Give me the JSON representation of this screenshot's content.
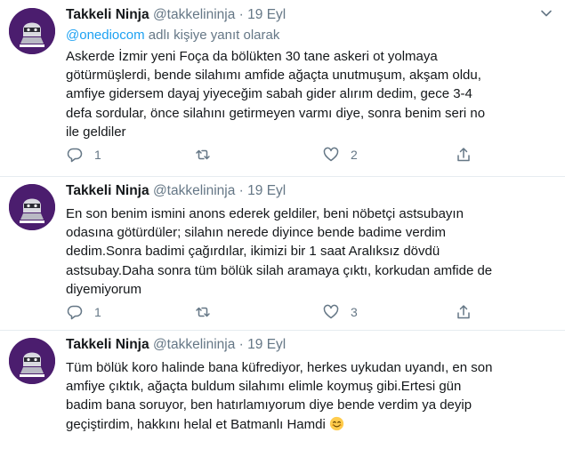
{
  "tweets": [
    {
      "name": "Takkeli Ninja",
      "handle": "@takkelininja",
      "dot": "·",
      "date": "19 Eyl",
      "reply_to": "@onediocom",
      "reply_suffix": " adlı kişiye yanıt olarak",
      "text": "Askerde İzmir yeni Foça da bölükten 30 tane askeri ot yolmaya\ngötürmüşlerdi, bende silahımı amfide ağaçta unutmuşum, akşam oldu,\namfiye gidersem dayaj yiyeceğim sabah gider alırım dedim, gece 3-4\ndefa sordular, önce silahını getirmeyen varmı diye, sonra benim seri no\nile geldiler",
      "reply_count": "1",
      "retweet_count": "",
      "like_count": "2"
    },
    {
      "name": "Takkeli Ninja",
      "handle": "@takkelininja",
      "dot": "·",
      "date": "19 Eyl",
      "text": "En son benim ismini anons ederek geldiler, beni nöbetçi astsubayın\nodasına götürdüler; silahın nerede diyince bende badime verdim\ndedim.Sonra badimi çağırdılar, ikimizi bir 1 saat Aralıksız dövdü\nastsubay.Daha sonra tüm bölük silah aramaya çıktı, korkudan amfide de\ndiyemiyorum",
      "reply_count": "1",
      "retweet_count": "",
      "like_count": "3"
    },
    {
      "name": "Takkeli Ninja",
      "handle": "@takkelininja",
      "dot": "·",
      "date": "19 Eyl",
      "text": "Tüm bölük koro halinde bana küfrediyor, herkes uykudan uyandı, en son\namfiye çıktık, ağaçta buldum silahımı elimle koymuş gibi.Ertesi gün\nbadim bana soruyor, ben hatırlamıyorum diye bende verdim ya deyip\ngeçiştirdim, hakkını helal et Batmanlı Hamdi ",
      "emoji": "smiling-face-icon"
    }
  ],
  "colors": {
    "name": "#14171a",
    "secondary": "#657786",
    "link": "#1da1f2",
    "divider": "#e6ecf0",
    "avatar_bg": "#4b1d6e"
  }
}
